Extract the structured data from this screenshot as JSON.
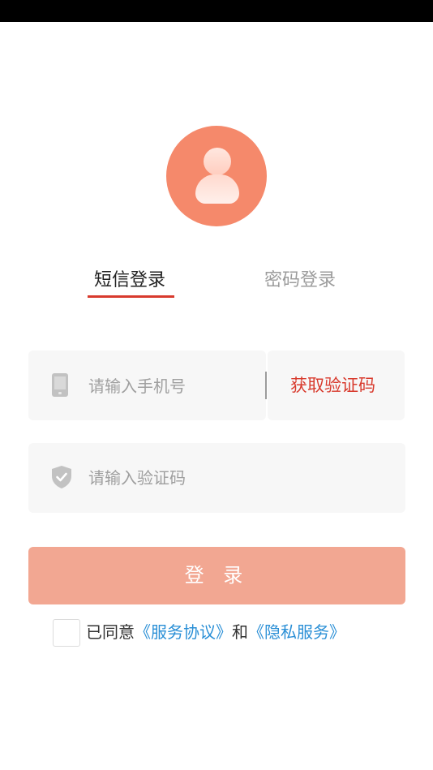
{
  "tabs": {
    "sms": "短信登录",
    "password": "密码登录"
  },
  "phone": {
    "placeholder": "请输入手机号",
    "get_code": "获取验证码"
  },
  "code": {
    "placeholder": "请输入验证码"
  },
  "login": {
    "label": "登 录"
  },
  "agreement": {
    "prefix": "已同意",
    "service_link": "《服务协议》",
    "connector": "和",
    "privacy_link": "《隐私服务》"
  },
  "colors": {
    "accent": "#d83a2d",
    "avatar": "#f5896b",
    "button": "#f2a792",
    "link": "#2a8fd6"
  },
  "icons": [
    "user-avatar-icon",
    "phone-icon",
    "shield-check-icon",
    "checkbox"
  ]
}
